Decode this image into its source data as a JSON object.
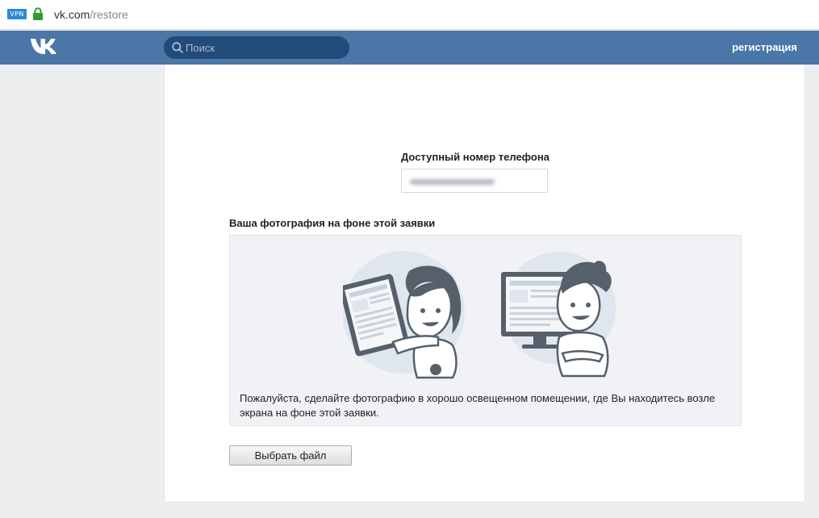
{
  "browser": {
    "vpn_badge": "VPN",
    "url_host": "vk.com",
    "url_path": "/restore"
  },
  "header": {
    "search_placeholder": "Поиск",
    "register_label": "регистрация",
    "brand_color": "#4a76a8"
  },
  "form": {
    "phone_label": "Доступный номер телефона",
    "photo_label": "Ваша фотография на фоне этой заявки",
    "instruction": "Пожалуйста, сделайте фотографию в хорошо освещенном помещении, где Вы находитесь возле экрана на фоне этой заявки.",
    "file_button": "Выбрать файл"
  },
  "icons": {
    "lock": "lock-icon",
    "logo": "vk-logo-icon",
    "search": "search-icon"
  }
}
